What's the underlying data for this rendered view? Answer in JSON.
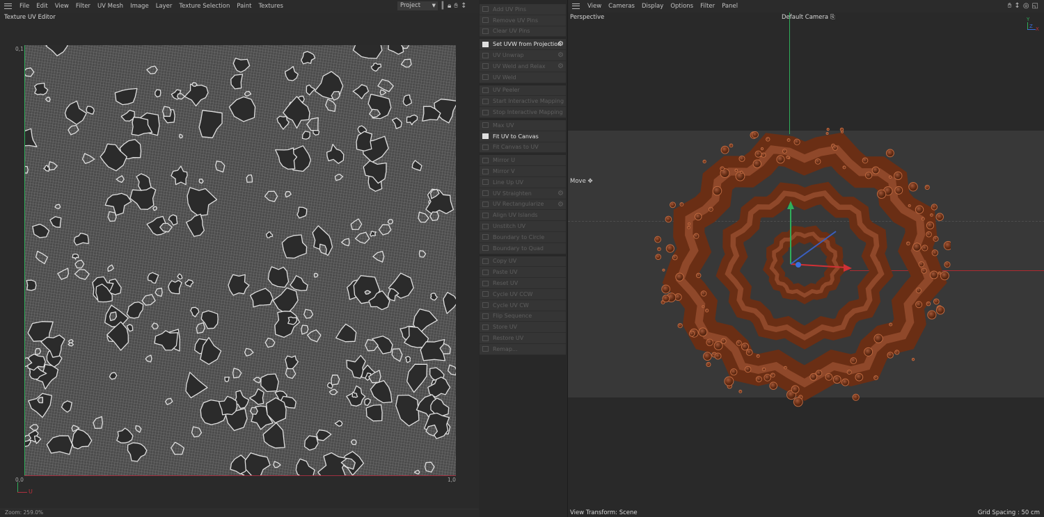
{
  "uv_editor": {
    "menu": [
      "File",
      "Edit",
      "View",
      "Filter",
      "UV Mesh",
      "Image",
      "Layer",
      "Texture Selection",
      "Paint",
      "Textures"
    ],
    "layout_select": "Project",
    "title": "Texture UV Editor",
    "top_left_label": "0,1",
    "origin_label": "0,0",
    "bottom_right_label": "1,0",
    "axis_u": "U",
    "zoom": "Zoom: 259.0%"
  },
  "uv_commands": {
    "groups": [
      [
        {
          "label": "Add UV Pins"
        },
        {
          "label": "Remove UV Pins"
        },
        {
          "label": "Clear UV Pins"
        }
      ],
      [
        {
          "label": "Set UVW from Projection",
          "enabled": true,
          "gear": true
        },
        {
          "label": "UV Unwrap",
          "gear": true
        },
        {
          "label": "UV Weld and Relax",
          "gear": true
        },
        {
          "label": "UV Weld"
        }
      ],
      [
        {
          "label": "UV Peeler"
        },
        {
          "label": "Start Interactive Mapping"
        },
        {
          "label": "Stop Interactive Mapping"
        }
      ],
      [
        {
          "label": "Max UV"
        },
        {
          "label": "Fit UV to Canvas",
          "enabled": true
        },
        {
          "label": "Fit Canvas to UV"
        }
      ],
      [
        {
          "label": "Mirror U"
        },
        {
          "label": "Mirror V"
        },
        {
          "label": "Line Up UV"
        },
        {
          "label": "UV Straighten",
          "gear": true
        },
        {
          "label": "UV Rectangularize",
          "gear": true
        },
        {
          "label": "Align UV Islands"
        },
        {
          "label": "Unstitch UV"
        },
        {
          "label": "Boundary to Circle"
        },
        {
          "label": "Boundary to Quad"
        }
      ],
      [
        {
          "label": "Copy UV"
        },
        {
          "label": "Paste UV"
        },
        {
          "label": "Reset UV"
        },
        {
          "label": "Cycle UV CCW"
        },
        {
          "label": "Cycle UV CW"
        },
        {
          "label": "Flip Sequence"
        },
        {
          "label": "Store UV"
        },
        {
          "label": "Restore UV"
        },
        {
          "label": "Remap..."
        }
      ]
    ]
  },
  "viewport": {
    "menu": [
      "View",
      "Cameras",
      "Display",
      "Options",
      "Filter",
      "Panel"
    ],
    "view_name": "Perspective",
    "camera": "Default Camera",
    "tool": "Move",
    "axis_labels": {
      "y": "Y",
      "z": "Z",
      "x": "X"
    },
    "view_transform": "View Transform: Scene",
    "grid_spacing": "Grid Spacing : 50 cm"
  },
  "colors": {
    "accent_red": "#c0303a",
    "accent_green": "#2fae5a",
    "chocolate": "#7a3a1c"
  }
}
